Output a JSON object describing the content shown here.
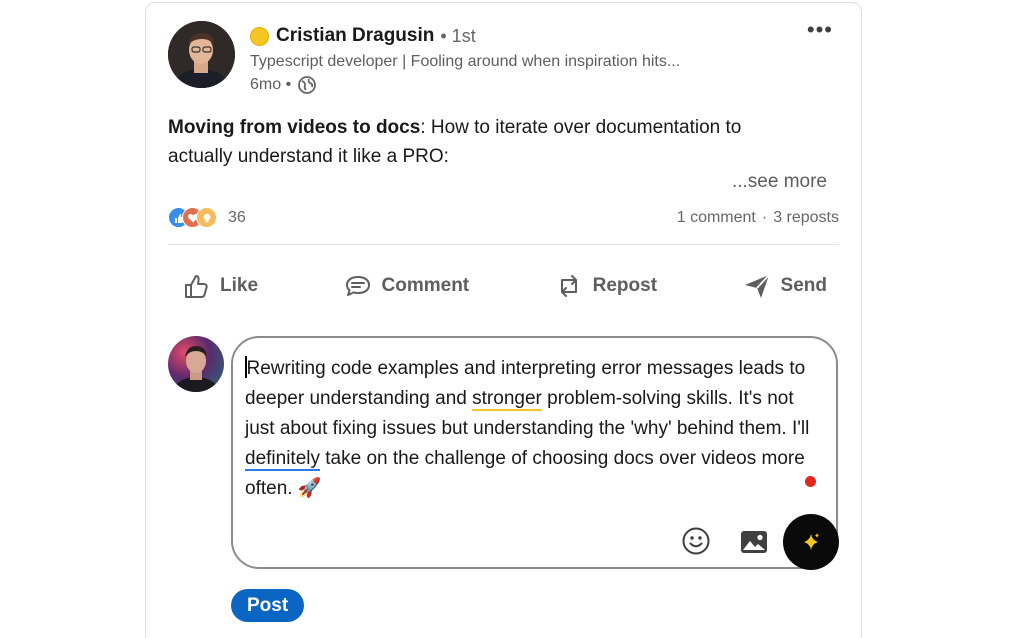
{
  "post": {
    "author": {
      "name": "Cristian Dragusin",
      "degree": "• 1st",
      "headline": "Typescript developer | Fooling around when inspiration hits...",
      "time": "6mo •"
    },
    "more_label": "•••",
    "text_bold": "Moving from videos to docs",
    "text_rest": ": How to iterate over documentation to actually understand it like a PRO:",
    "see_more": "...see more",
    "reaction_count": "36",
    "comments": "1 comment",
    "separator": "·",
    "reposts": "3 reposts"
  },
  "actions": [
    {
      "label": "Like",
      "icon": "thumbs-up-icon"
    },
    {
      "label": "Comment",
      "icon": "comment-icon"
    },
    {
      "label": "Repost",
      "icon": "repost-icon"
    },
    {
      "label": "Send",
      "icon": "send-icon"
    }
  ],
  "composer": {
    "seg1": "Rewriting code examples and interpreting error messages leads to deeper understanding and ",
    "seg2": "stronger",
    "seg3": " problem-solving skills. It's not just about fixing issues but understanding the 'why' behind them. I'll ",
    "seg4": "definitely",
    "seg5": " take on the challenge of choosing docs over videos more often. 🚀"
  },
  "post_button": "Post",
  "colors": {
    "brand_blue": "#0a66c2",
    "status_yellow": "#f3c623",
    "notification_red": "#e0281f"
  }
}
